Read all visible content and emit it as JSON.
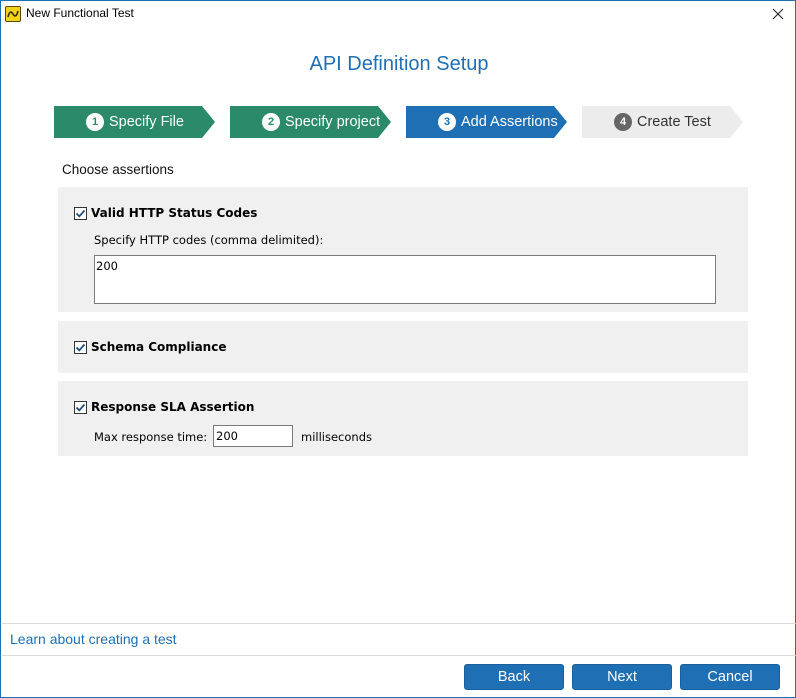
{
  "window": {
    "title": "New Functional Test",
    "close_icon": "close-icon"
  },
  "page_title": "API Definition Setup",
  "colors": {
    "accent": "#1f6fb4",
    "step_done": "#2a8a6a",
    "step_active": "#1f6fb4",
    "step_pending": "#ececec",
    "panel": "#f0f0f0"
  },
  "steps": [
    {
      "number": "1",
      "label": "Specify File",
      "state": "done"
    },
    {
      "number": "2",
      "label": "Specify project",
      "state": "done"
    },
    {
      "number": "3",
      "label": "Add Assertions",
      "state": "active"
    },
    {
      "number": "4",
      "label": "Create Test",
      "state": "pending"
    }
  ],
  "section_label": "Choose assertions",
  "assertions": {
    "status_codes": {
      "label": "Valid HTTP Status Codes",
      "checked": true,
      "codes_label": "Specify HTTP codes (comma delimited):",
      "codes_value": "200"
    },
    "schema": {
      "label": "Schema Compliance",
      "checked": true
    },
    "sla": {
      "label": "Response SLA Assertion",
      "checked": true,
      "max_label": "Max response time:",
      "max_value": "200",
      "unit": "milliseconds"
    }
  },
  "footer": {
    "help_link": "Learn about creating a test",
    "back": "Back",
    "next": "Next",
    "cancel": "Cancel"
  }
}
